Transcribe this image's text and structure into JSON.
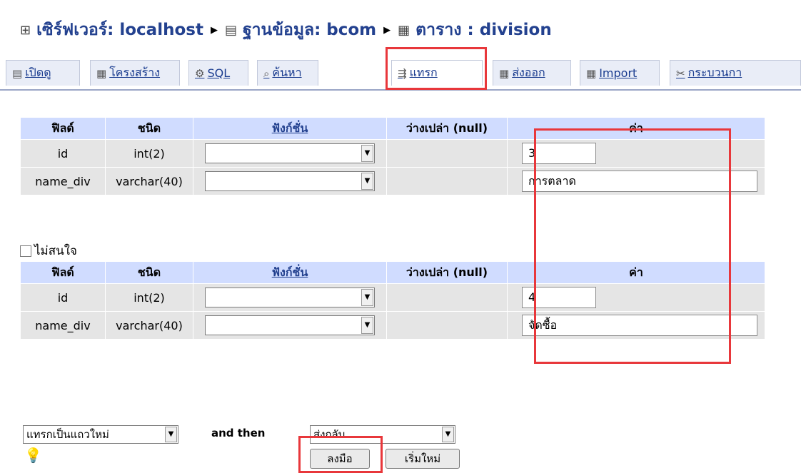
{
  "breadcrumb": {
    "server": "เซิร์ฟเวอร์: localhost",
    "database": "ฐานข้อมูล: bcom",
    "table": "ตาราง : division"
  },
  "tabs": [
    {
      "label": "เปิดดู",
      "icon": "browse-icon"
    },
    {
      "label": "โครงสร้าง",
      "icon": "structure-icon"
    },
    {
      "label": "SQL",
      "icon": "sql-icon"
    },
    {
      "label": "ค้นหา",
      "icon": "search-icon"
    },
    {
      "label": "แทรก",
      "icon": "insert-icon"
    },
    {
      "label": "ส่งออก",
      "icon": "export-icon"
    },
    {
      "label": "Import",
      "icon": "import-icon"
    },
    {
      "label": "กระบวนกา",
      "icon": "operations-icon"
    }
  ],
  "columns": {
    "field": "ฟิลด์",
    "type": "ชนิด",
    "function": "ฟังก์ชั่น",
    "null": "ว่างเปล่า (null)",
    "value": "ค่า"
  },
  "form1": {
    "rows": [
      {
        "field": "id",
        "type": "int(2)",
        "value": "3"
      },
      {
        "field": "name_div",
        "type": "varchar(40)",
        "value": "การตลาด"
      }
    ]
  },
  "ignore_label": "ไม่สนใจ",
  "form2": {
    "rows": [
      {
        "field": "id",
        "type": "int(2)",
        "value": "4"
      },
      {
        "field": "name_div",
        "type": "varchar(40)",
        "value": "จัดซื้อ"
      }
    ]
  },
  "bottom": {
    "insert_mode": "แทรกเป็นแถวใหม่",
    "and_then": "and then",
    "after": "ส่งกลับ",
    "go_button": "ลงมือ",
    "reset_button": "เริ่มใหม่"
  },
  "colors": {
    "highlight": "#e8373b",
    "header_bg": "#d0dcff",
    "link": "#23418f"
  }
}
